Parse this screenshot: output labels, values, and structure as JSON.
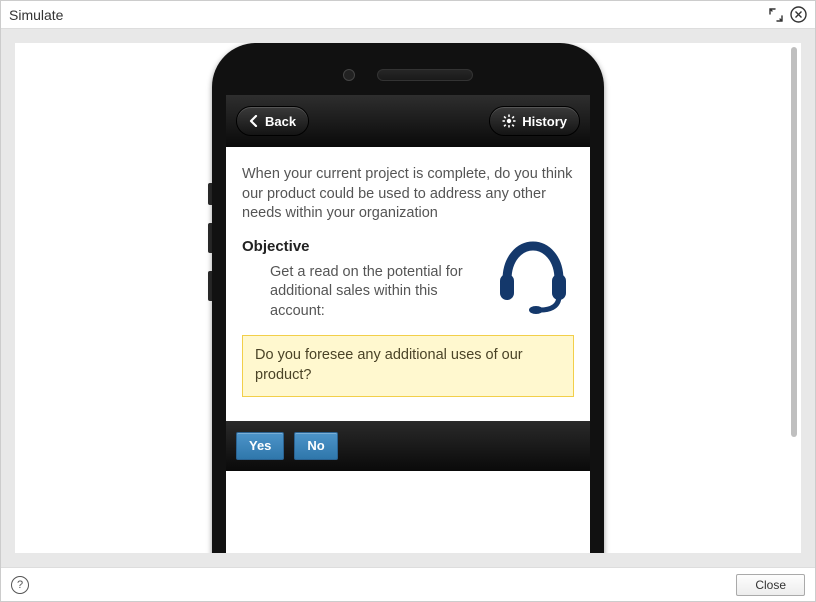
{
  "window": {
    "title": "Simulate",
    "close_label": "Close"
  },
  "nav": {
    "back_label": "Back",
    "history_label": "History"
  },
  "page": {
    "question": "When your current project is complete, do you think our product could be used to address any other needs within your organization",
    "objective_heading": "Objective",
    "objective_text": "Get a read on the potential for additional sales within this account:",
    "prompt": "Do you foresee any additional uses of our product?"
  },
  "actions": {
    "yes": "Yes",
    "no": "No"
  }
}
